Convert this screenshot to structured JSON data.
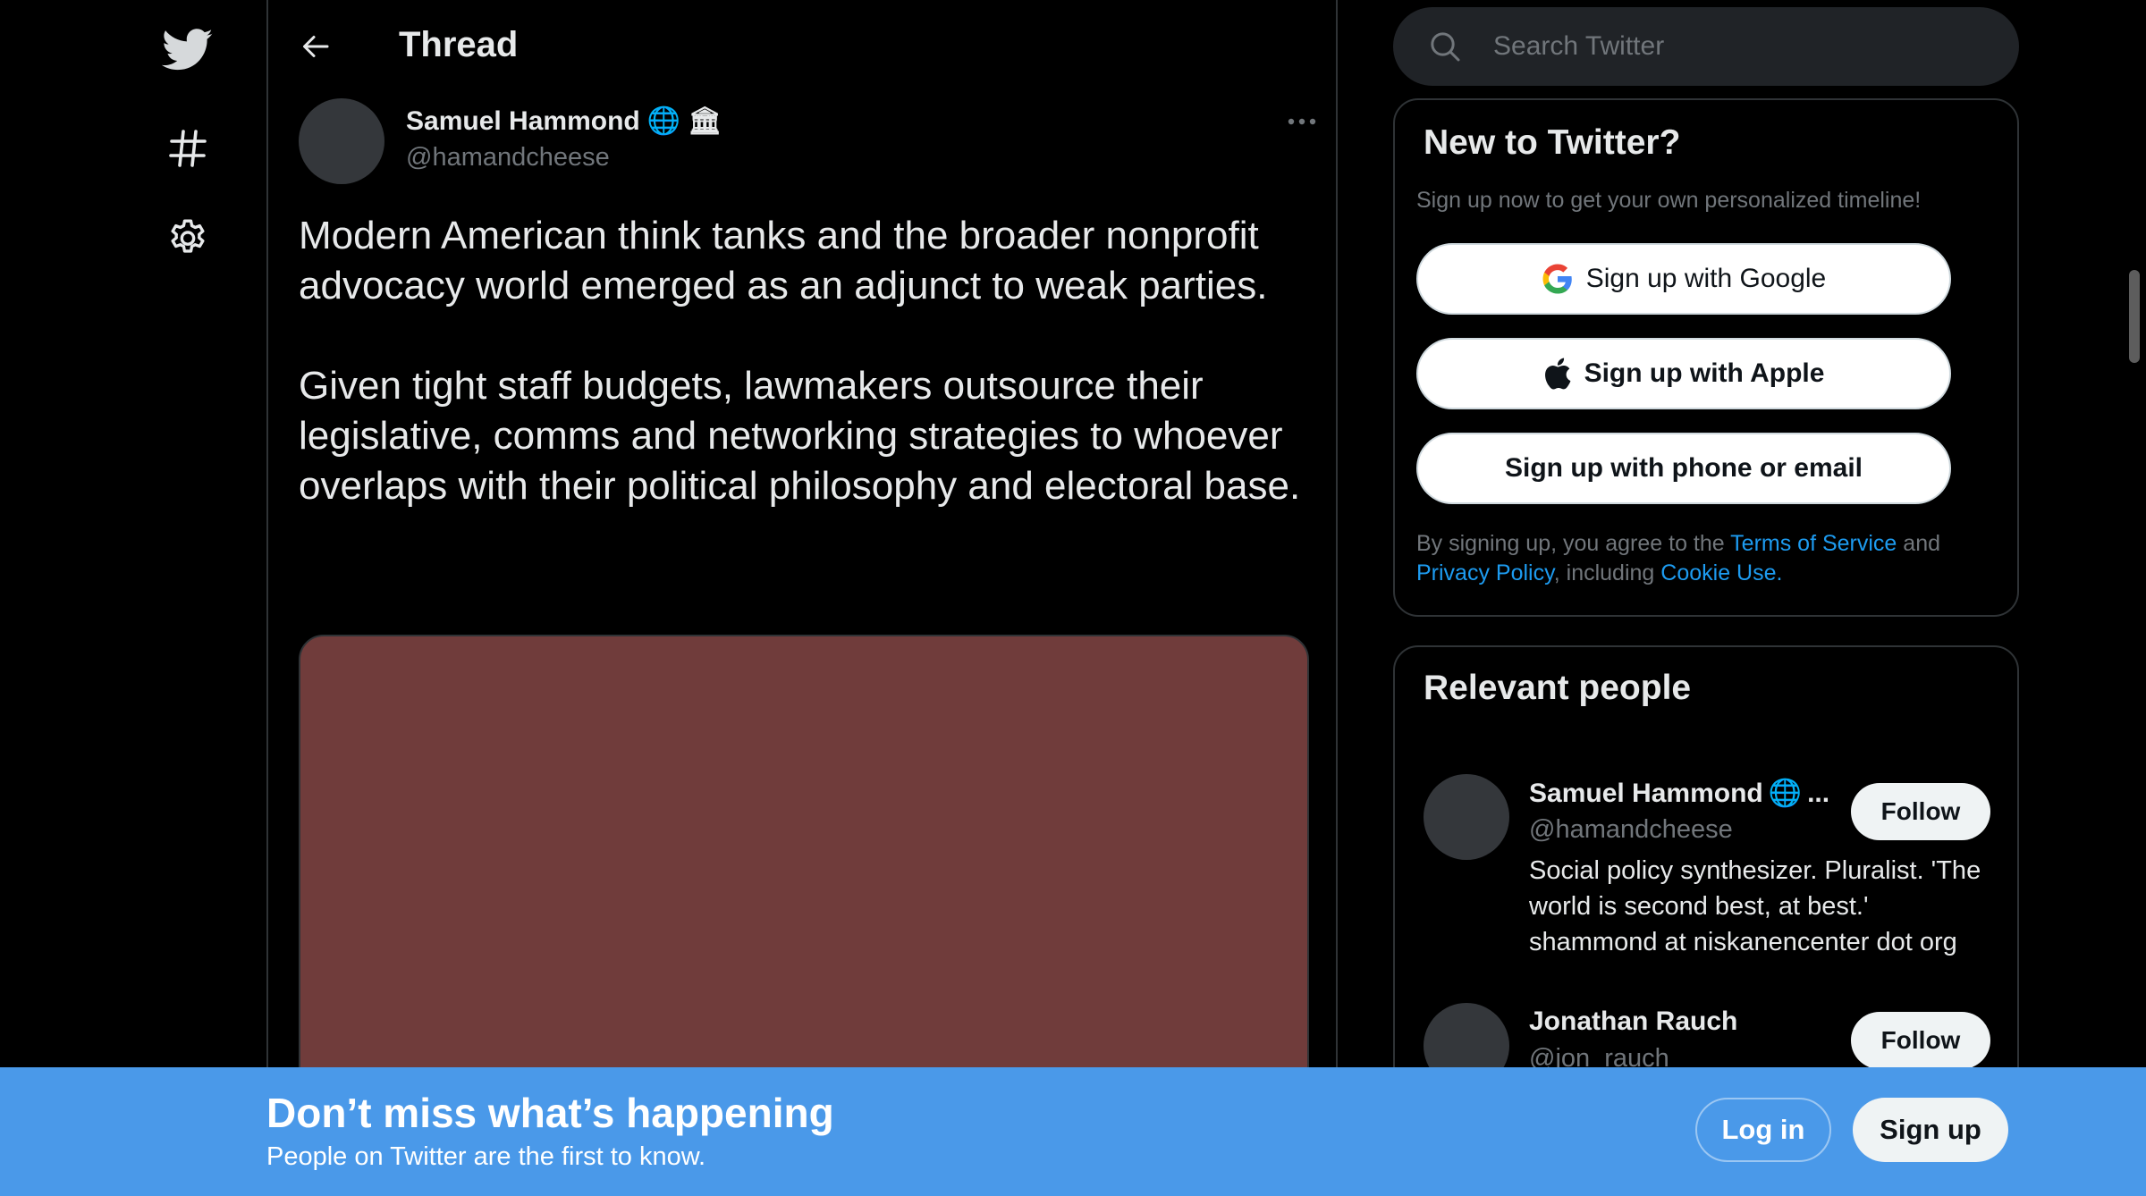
{
  "nav": {
    "items": [
      {
        "icon": "twitter-logo-icon"
      },
      {
        "icon": "hashtag-icon"
      },
      {
        "icon": "gear-icon"
      }
    ]
  },
  "header": {
    "title": "Thread"
  },
  "tweet": {
    "author_name": "Samuel Hammond",
    "author_handle": "@hamandcheese",
    "badges": [
      "🌐",
      "🏛"
    ],
    "text": "Modern American think tanks and the broader nonprofit advocacy world emerged as an adjunct to weak parties.\n\nGiven tight staff budgets, lawmakers outsource their legislative, comms and networking strategies to whoever overlaps with their political philosophy and electoral base.",
    "media_color": "#703c3b"
  },
  "search": {
    "placeholder": "Search Twitter"
  },
  "signup_card": {
    "title": "New to Twitter?",
    "subtitle": "Sign up now to get your own personalized timeline!",
    "google_label": "Sign up with Google",
    "apple_label": "Sign up with Apple",
    "phone_label": "Sign up with phone or email",
    "legal": {
      "prefix": "By signing up, you agree to the ",
      "terms": "Terms of Service",
      "and": " and ",
      "privacy": "Privacy Policy",
      "including": ", including ",
      "cookie": "Cookie Use."
    }
  },
  "people_card": {
    "title": "Relevant people",
    "people": [
      {
        "name": "Samuel Hammond",
        "badge": "🌐",
        "ellipsis": "...",
        "handle": "@hamandcheese",
        "bio": "Social policy synthesizer. Pluralist. 'The world is second best, at best.' shammond at niskanencenter dot org",
        "follow_label": "Follow"
      },
      {
        "name": "Jonathan Rauch",
        "handle": "@jon_rauch",
        "follow_label": "Follow"
      }
    ]
  },
  "banner": {
    "title": "Don’t miss what’s happening",
    "subtitle": "People on Twitter are the first to know.",
    "login_label": "Log in",
    "signup_label": "Sign up"
  },
  "colors": {
    "accent": "#1d9bf0",
    "banner": "#4a99e9",
    "background": "#000000"
  }
}
